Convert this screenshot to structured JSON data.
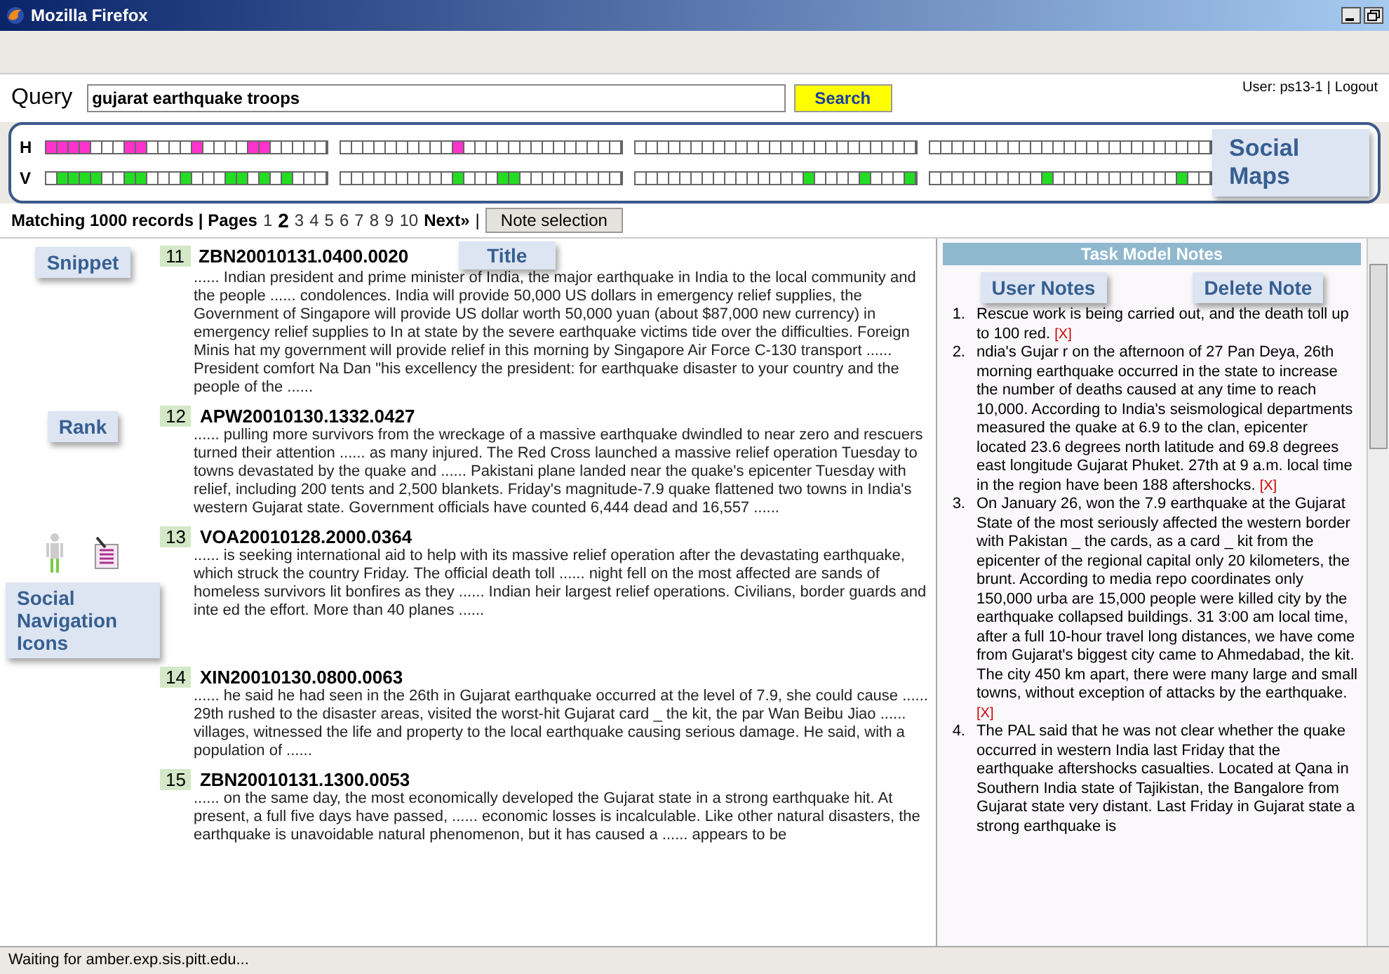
{
  "window": {
    "title": "Mozilla Firefox"
  },
  "query": {
    "label": "Query",
    "value": "gujarat earthquake troops",
    "button": "Search"
  },
  "user": {
    "text": "User: ps13-1",
    "separator": "|",
    "logout": "Logout"
  },
  "callouts": {
    "social_maps": "Social Maps",
    "title": "Title",
    "snippet": "Snippet",
    "rank": "Rank",
    "social_nav": "Social  Navigation Icons",
    "user_notes": "User Notes",
    "delete_note": "Delete Note"
  },
  "social_maps": {
    "rows": [
      {
        "label": "H",
        "kind": "history",
        "groups": [
          [
            true,
            true,
            true,
            true,
            false,
            false,
            false,
            true,
            true,
            false,
            false,
            false,
            false,
            true,
            false,
            false,
            false,
            false,
            true,
            true,
            false,
            false,
            false,
            false,
            false
          ],
          [
            false,
            false,
            false,
            false,
            false,
            false,
            false,
            false,
            false,
            false,
            true,
            false,
            false,
            false,
            false,
            false,
            false,
            false,
            false,
            false,
            false,
            false,
            false,
            false,
            false
          ],
          [
            false,
            false,
            false,
            false,
            false,
            false,
            false,
            false,
            false,
            false,
            false,
            false,
            false,
            false,
            false,
            false,
            false,
            false,
            false,
            false,
            false,
            false,
            false,
            false,
            false
          ],
          [
            false,
            false,
            false,
            false,
            false,
            false,
            false,
            false,
            false,
            false,
            false,
            false,
            false,
            false,
            false,
            false,
            false,
            false,
            false,
            false,
            false,
            false,
            false,
            false,
            false
          ]
        ]
      },
      {
        "label": "V",
        "kind": "visit",
        "groups": [
          [
            false,
            true,
            true,
            true,
            true,
            false,
            false,
            true,
            true,
            false,
            false,
            false,
            true,
            false,
            false,
            false,
            true,
            true,
            false,
            true,
            false,
            true,
            false,
            false,
            false
          ],
          [
            false,
            false,
            false,
            false,
            false,
            false,
            false,
            false,
            false,
            false,
            true,
            false,
            false,
            false,
            true,
            true,
            false,
            false,
            false,
            false,
            false,
            false,
            false,
            false,
            false
          ],
          [
            false,
            false,
            false,
            false,
            false,
            false,
            false,
            false,
            false,
            false,
            false,
            false,
            false,
            false,
            false,
            true,
            false,
            false,
            false,
            false,
            true,
            false,
            false,
            false,
            true
          ],
          [
            false,
            false,
            false,
            false,
            false,
            false,
            false,
            false,
            false,
            false,
            true,
            false,
            false,
            false,
            false,
            false,
            false,
            false,
            false,
            false,
            false,
            false,
            true,
            false,
            false
          ]
        ]
      }
    ]
  },
  "pager": {
    "summary": "Matching 1000 records | Pages",
    "pages": [
      {
        "label": "1",
        "selected": false
      },
      {
        "label": "2",
        "selected": true
      },
      {
        "label": "3",
        "selected": false
      },
      {
        "label": "4",
        "selected": false
      },
      {
        "label": "5",
        "selected": false
      },
      {
        "label": "6",
        "selected": false
      },
      {
        "label": "7",
        "selected": false
      },
      {
        "label": "8",
        "selected": false
      },
      {
        "label": "9",
        "selected": false
      },
      {
        "label": "10",
        "selected": false
      }
    ],
    "next": "Next»",
    "separator": "|",
    "note_button": "Note selection"
  },
  "results": [
    {
      "rank": "11",
      "title": "ZBN20010131.0400.0020",
      "snippet": "...... Indian president and prime minister of India, the major earthquake in India to the local community and the people ...... condolences. India will provide 50,000 US dollars in emergency relief supplies, the Government of Singapore will provide US dollar worth 50,000 yuan (about $87,000 new currency) in emergency relief supplies to In at state by the severe earthquake victims tide over the difficulties. Foreign Minis hat my government will provide relief in this morning by Singapore Air Force C-130 transport ...... President comfort Na Dan \"his excellency the president: for earthquake disaster to your country and the people of the ......",
      "icons": false
    },
    {
      "rank": "12",
      "title": "APW20010130.1332.0427",
      "snippet": "...... pulling more survivors from the wreckage of a massive earthquake dwindled to near zero and rescuers turned their attention ...... as many injured. The Red Cross launched a massive relief operation Tuesday to towns devastated by the quake and ...... Pakistani plane landed near the quake's epicenter Tuesday with relief, including 200 tents and 2,500 blankets. Friday's magnitude-7.9 quake flattened two towns in India's western Gujarat state. Government officials have counted 6,444 dead and 16,557 ......",
      "icons": false
    },
    {
      "rank": "13",
      "title": "VOA20010128.2000.0364",
      "snippet": "...... is seeking international aid to help with its massive relief operation after the devastating earthquake, which struck the country Friday. The official death toll ...... night fell on the most affected are sands of homeless survivors lit bonfires as they ...... Indian heir largest relief operations. Civilians, border guards and inte ed the effort. More than 40 planes ......",
      "icons": true
    },
    {
      "rank": "14",
      "title": "XIN20010130.0800.0063",
      "snippet": "...... he said he had seen in the 26th in Gujarat earthquake occurred at the level of 7.9, she could cause ...... 29th rushed to the disaster areas, visited the worst-hit Gujarat card _ the kit, the par Wan Beibu Jiao ...... villages, witnessed the life and property to the local earthquake causing serious damage. He said, with a population of ......",
      "icons": false
    },
    {
      "rank": "15",
      "title": "ZBN20010131.1300.0053",
      "snippet": "...... on the same day, the most economically developed the Gujarat state in a strong earthquake hit. At present, a full five days have passed, ...... economic losses is incalculable. Like other natural disasters, the earthquake is unavoidable natural phenomenon, but it has caused a ...... appears to be",
      "icons": false
    }
  ],
  "notes": {
    "title": "Task Model Notes",
    "items": [
      {
        "number": "1.",
        "text": "Rescue work is being carried out, and the death toll up to 100 red.",
        "delete": "[X]"
      },
      {
        "number": "2.",
        "text": "ndia's Gujar r on the afternoon of 27 Pan Deya, 26th morning earthquake occurred in the state to increase the number of deaths caused at any time to reach 10,000. According to India's seismological departments measured the quake at 6.9 to the clan, epicenter located 23.6 degrees north latitude and 69.8 degrees east longitude Gujarat Phuket. 27th at 9 a.m. local time in the region have been 188 aftershocks.",
        "delete": "[X]"
      },
      {
        "number": "3.",
        "text": "On January 26, won the 7.9 earthquake at the Gujarat State of the most seriously affected the western border with Pakistan _ the cards, as a card _ kit from the epicenter of the regional capital only 20 kilometers, the brunt. According to media repo coordinates only 150,000 urba are 15,000 people were killed city by the earthquake collapsed buildings. 31 3:00 am local time, after a full 10-hour travel long distances, we have come from Gujarat's biggest city came to Ahmedabad, the kit. The city 450 km apart, there were many large and small towns, without exception of attacks by the earthquake.",
        "delete": "[X]"
      },
      {
        "number": "4.",
        "text": "The PAL said that he was not clear whether the quake occurred in western India last Friday that the earthquake aftershocks casualties. Located at Qana in Southern India state of Tajikistan, the Bangalore from Gujarat state very distant. Last Friday in Gujarat state a strong earthquake is"
      }
    ]
  },
  "status_bar": "Waiting for amber.exp.sis.pitt.edu..."
}
